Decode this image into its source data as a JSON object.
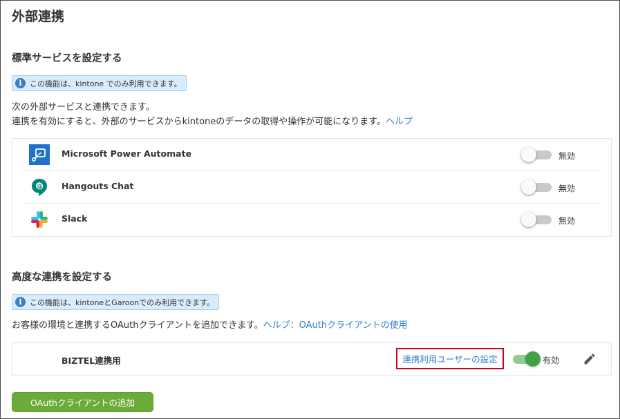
{
  "page": {
    "title": "外部連携"
  },
  "standard": {
    "heading": "標準サービスを設定する",
    "notice": "この機能は、kintone でのみ利用できます。",
    "desc_line1": "次の外部サービスと連携できます。",
    "desc_line2": "連携を有効にすると、外部のサービスからkintoneのデータの取得や操作が可能になります。",
    "help_link": "ヘルプ",
    "services": [
      {
        "name": "Microsoft Power Automate",
        "icon": "power-automate-icon",
        "enabled": false,
        "status": "無効"
      },
      {
        "name": "Hangouts Chat",
        "icon": "hangouts-chat-icon",
        "enabled": false,
        "status": "無効"
      },
      {
        "name": "Slack",
        "icon": "slack-icon",
        "enabled": false,
        "status": "無効"
      }
    ]
  },
  "advanced": {
    "heading": "高度な連携を設定する",
    "notice": "この機能は、kintoneとGaroonでのみ利用できます。",
    "desc": "お客様の環境と連携するOAuthクライアントを追加できます。",
    "help_link": "ヘルプ：OAuthクライアントの使用",
    "clients": [
      {
        "name": "BIZTEL連携用",
        "user_setting_label": "連携利用ユーザーの設定",
        "enabled": true,
        "status": "有効",
        "edit_icon": "pencil-icon"
      }
    ],
    "add_button": "OAuthクライアントの追加"
  },
  "colors": {
    "link": "#2b7fd0",
    "toggle_on": "#43a047",
    "add_button": "#6bab3a",
    "highlight_border": "#d0021b",
    "notice_bg": "#d8ecfb"
  }
}
